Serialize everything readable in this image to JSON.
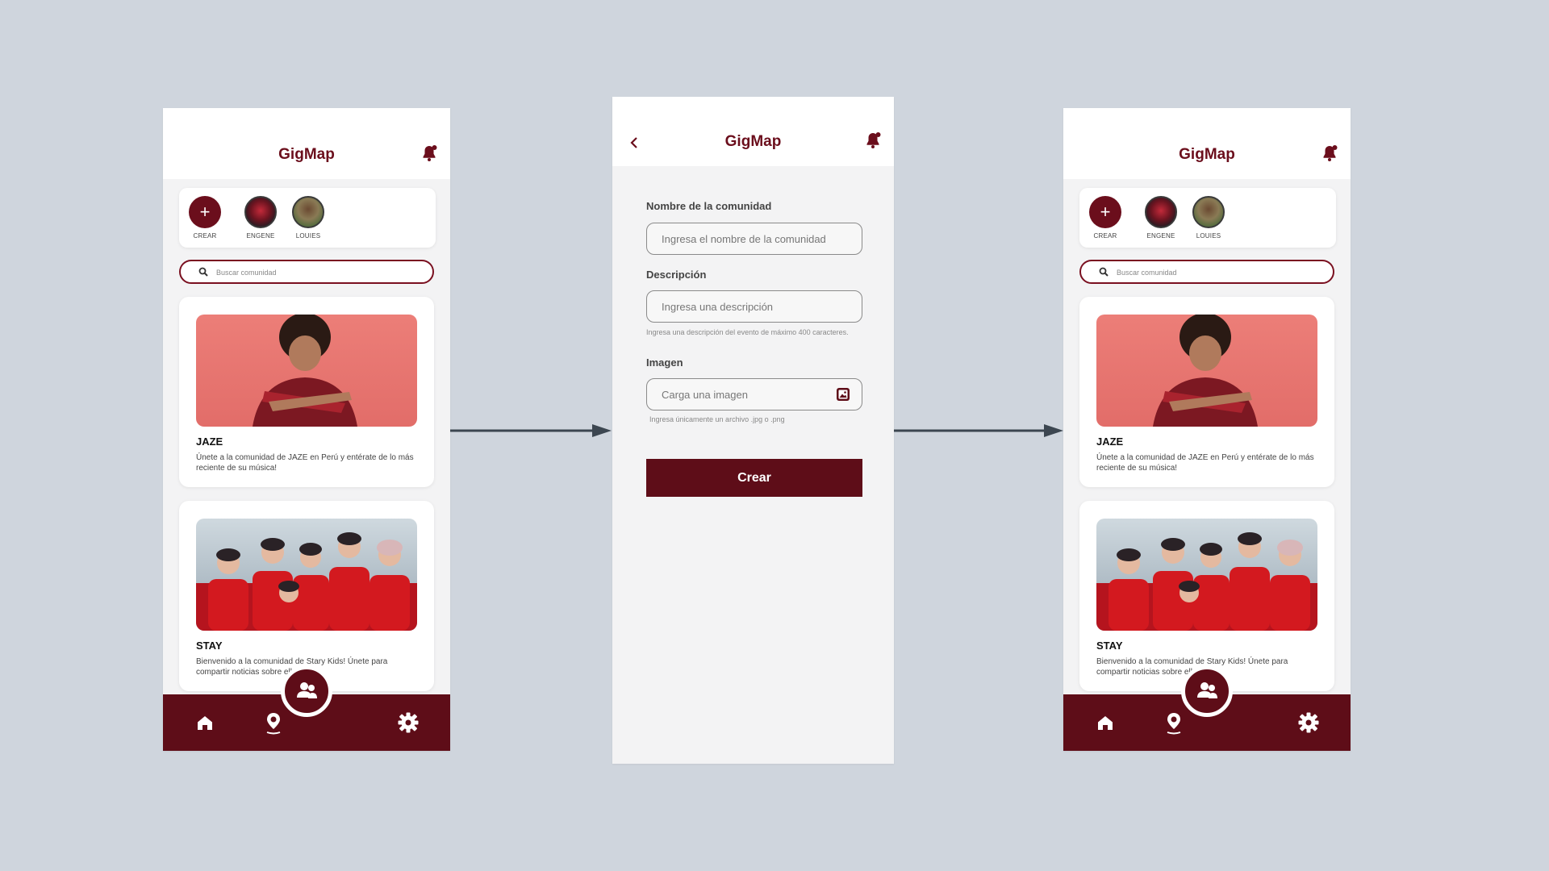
{
  "app": {
    "title": "GigMap"
  },
  "colors": {
    "brand": "#5e0d18",
    "title": "#6b0e1c",
    "background": "#cfd5dd"
  },
  "list_screen": {
    "stories": [
      {
        "label": "CREAR",
        "icon": "plus-icon"
      },
      {
        "label": "ENGENE",
        "icon": "avatar"
      },
      {
        "label": "LOUIES",
        "icon": "avatar"
      }
    ],
    "search": {
      "placeholder": "Buscar comunidad"
    },
    "communities": [
      {
        "title": "JAZE",
        "description": "Únete a la comunidad de JAZE en Perú y entérate de lo más reciente de su música!"
      },
      {
        "title": "STAY",
        "description": "Bienvenido a la comunidad de Stary Kids! Únete para compartir noticias sobre ellos!"
      }
    ],
    "nav": [
      "home-icon",
      "map-pin-icon",
      "community-icon",
      "gear-icon"
    ]
  },
  "form_screen": {
    "name_label": "Nombre de la comunidad",
    "name_placeholder": "Ingresa el nombre de la comunidad",
    "desc_label": "Descripción",
    "desc_placeholder": "Ingresa una descripción",
    "desc_hint": "Ingresa una descripción del evento de máximo 400 caracteres.",
    "image_label": "Imagen",
    "image_placeholder": "Carga una imagen",
    "image_hint": "Ingresa únicamente un archivo .jpg o .png",
    "submit": "Crear"
  }
}
